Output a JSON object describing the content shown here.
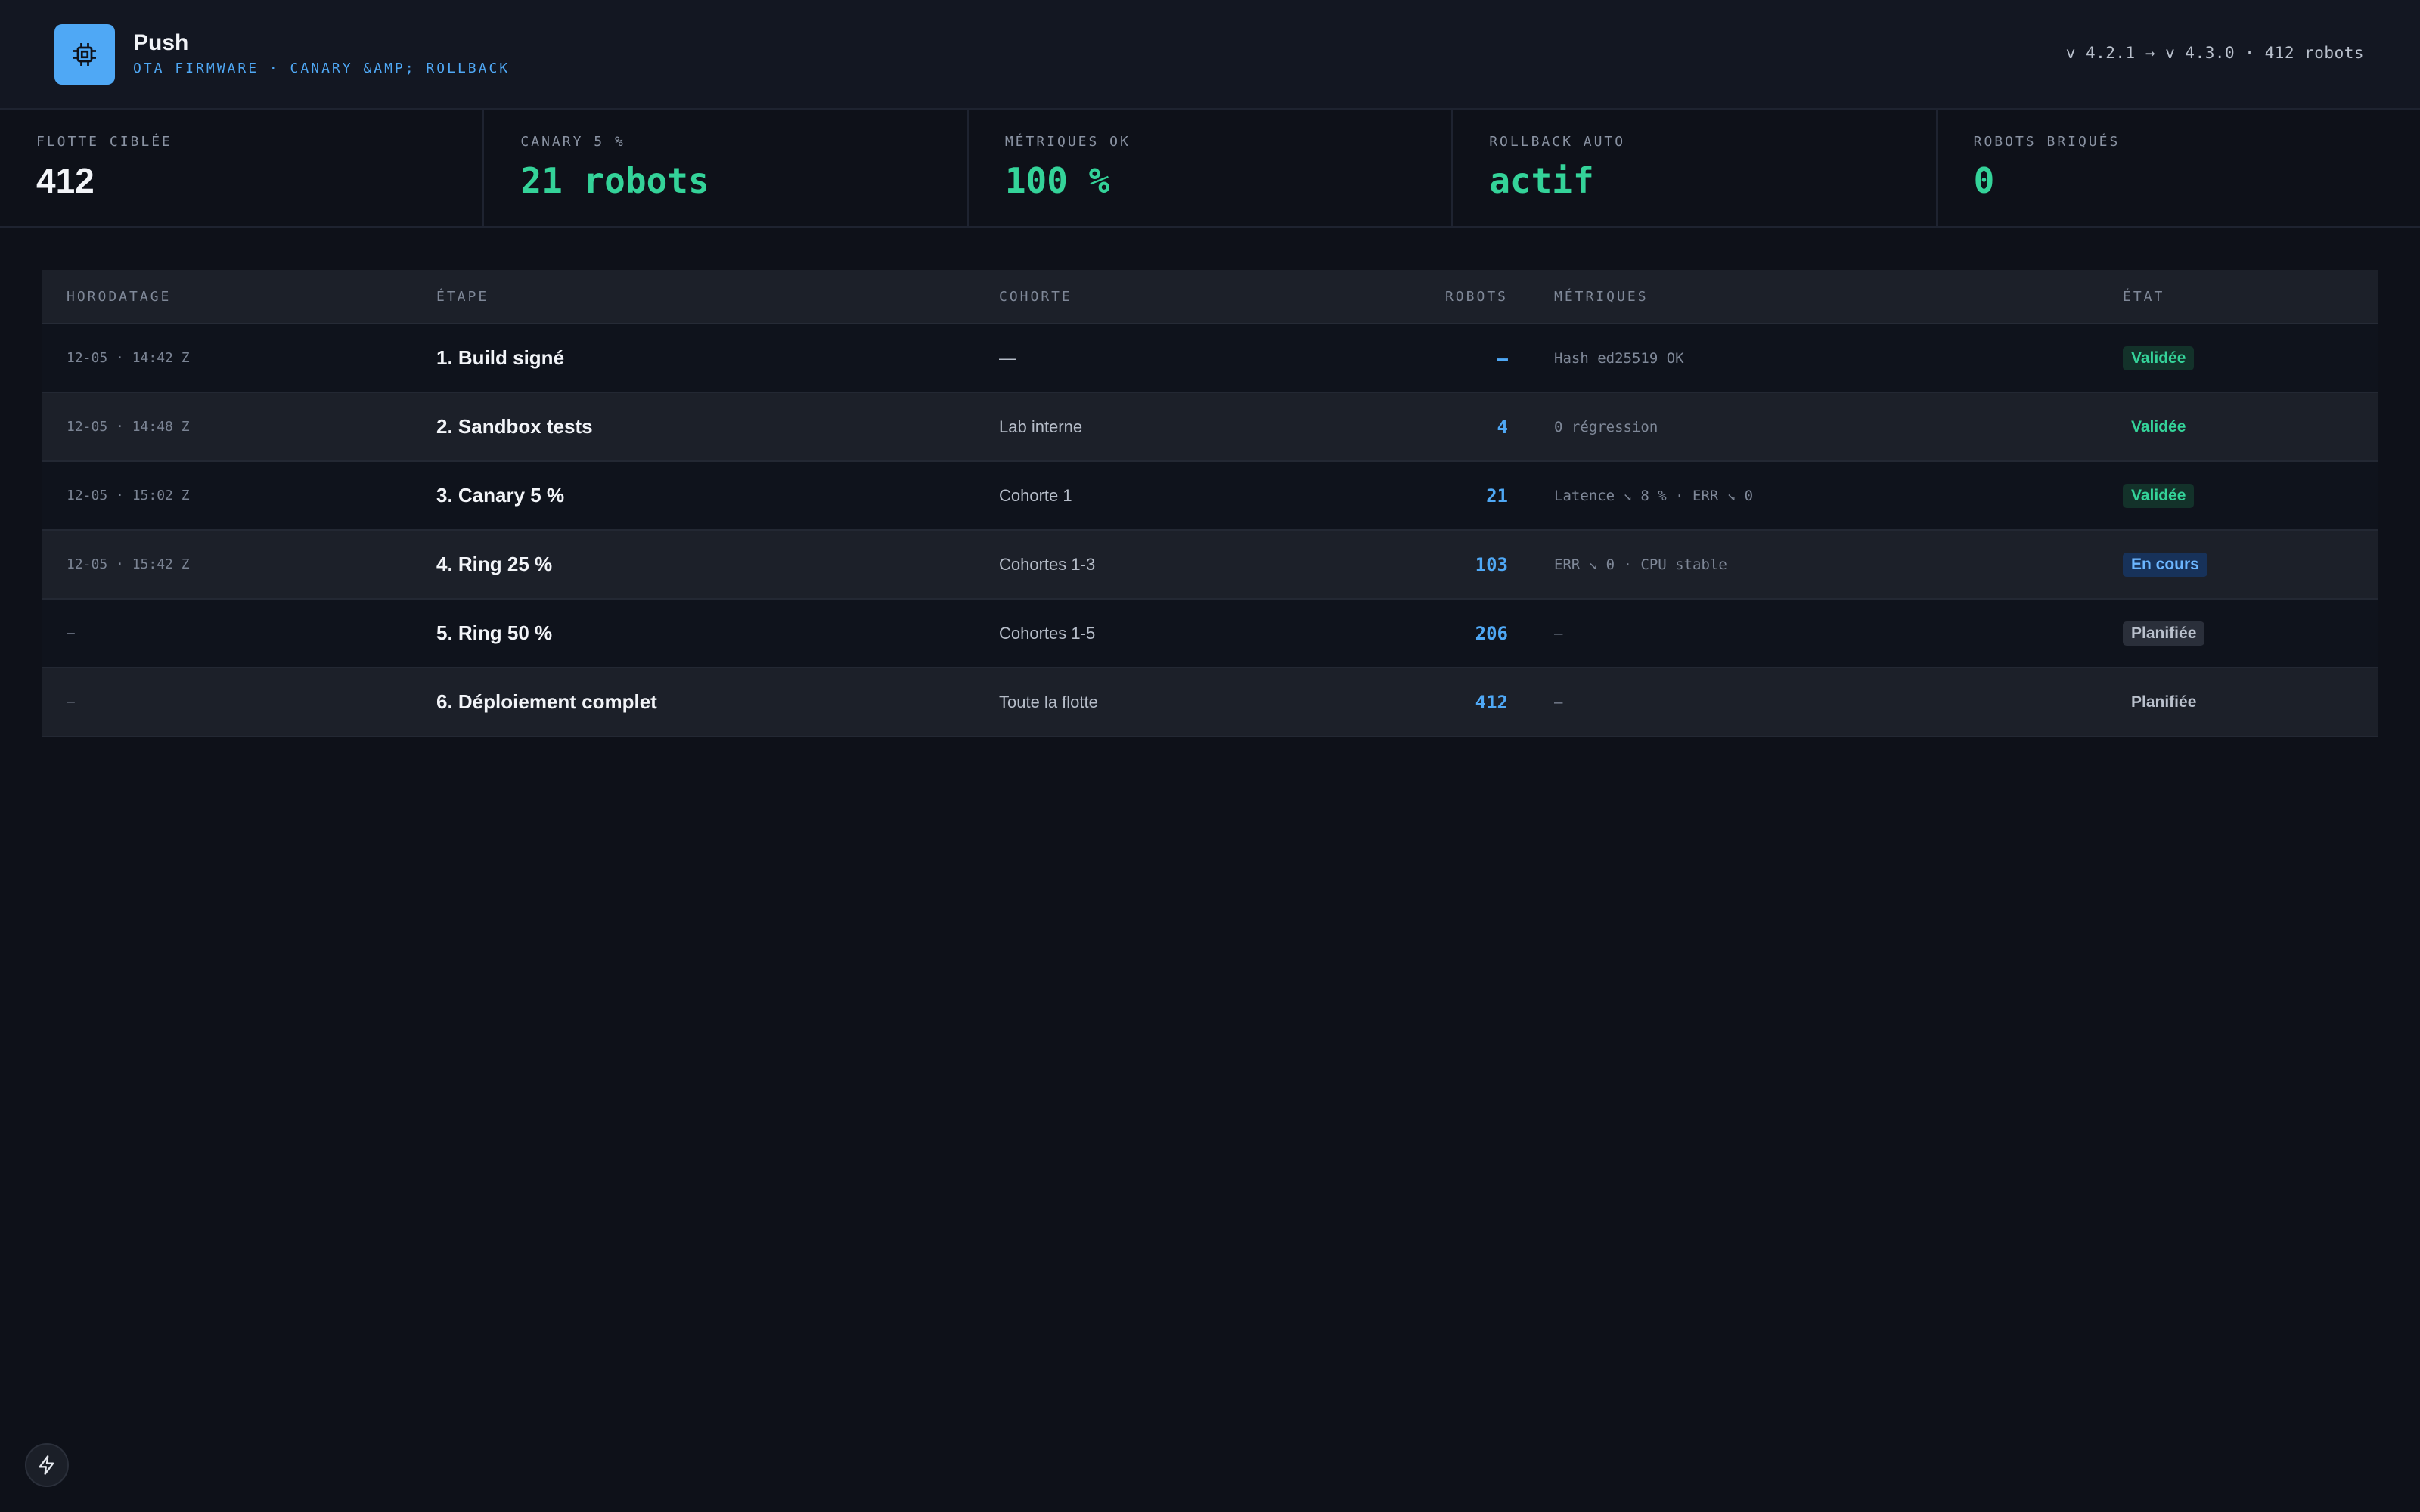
{
  "app": {
    "title": "Push",
    "subtitle": "OTA FIRMWARE · CANARY &AMP; ROLLBACK",
    "version_info": "v 4.2.1 → v 4.3.0 · 412 robots",
    "logo_icon": "chip-icon",
    "accent": "#4fa8f5"
  },
  "kpis": [
    {
      "label": "FLOTTE CIBLÉE",
      "value": "412"
    },
    {
      "label": "CANARY 5 %",
      "value": "21 robots"
    },
    {
      "label": "MÉTRIQUES OK",
      "value": "100 %"
    },
    {
      "label": "ROLLBACK AUTO",
      "value": "actif"
    },
    {
      "label": "ROBOTS BRIQUÉS",
      "value": "0"
    }
  ],
  "table": {
    "headers": {
      "time": "HORODATAGE",
      "step": "ÉTAPE",
      "cohort": "COHORTE",
      "robots": "ROBOTS",
      "metrics": "MÉTRIQUES",
      "state": "ÉTAT"
    },
    "rows": [
      {
        "time": "12-05 · 14:42 Z",
        "step": "1. Build signé",
        "cohort": "—",
        "robots": "—",
        "metrics": "Hash ed25519 OK",
        "state": "Validée"
      },
      {
        "time": "12-05 · 14:48 Z",
        "step": "2. Sandbox tests",
        "cohort": "Lab interne",
        "robots": "4",
        "metrics": "0 régression",
        "state": "Validée"
      },
      {
        "time": "12-05 · 15:02 Z",
        "step": "3. Canary 5 %",
        "cohort": "Cohorte 1",
        "robots": "21",
        "metrics": "Latence ↘ 8 % · ERR ↘ 0",
        "state": "Validée"
      },
      {
        "time": "12-05 · 15:42 Z",
        "step": "4. Ring 25 %",
        "cohort": "Cohortes 1-3",
        "robots": "103",
        "metrics": "ERR ↘ 0 · CPU stable",
        "state": "En cours"
      },
      {
        "time": "–",
        "step": "5. Ring 50 %",
        "cohort": "Cohortes 1-5",
        "robots": "206",
        "metrics": "–",
        "state": "Planifiée"
      },
      {
        "time": "–",
        "step": "6. Déploiement complet",
        "cohort": "Toute la flotte",
        "robots": "412",
        "metrics": "–",
        "state": "Planifiée"
      }
    ]
  },
  "footer": {
    "bolt_icon": "bolt-icon"
  }
}
